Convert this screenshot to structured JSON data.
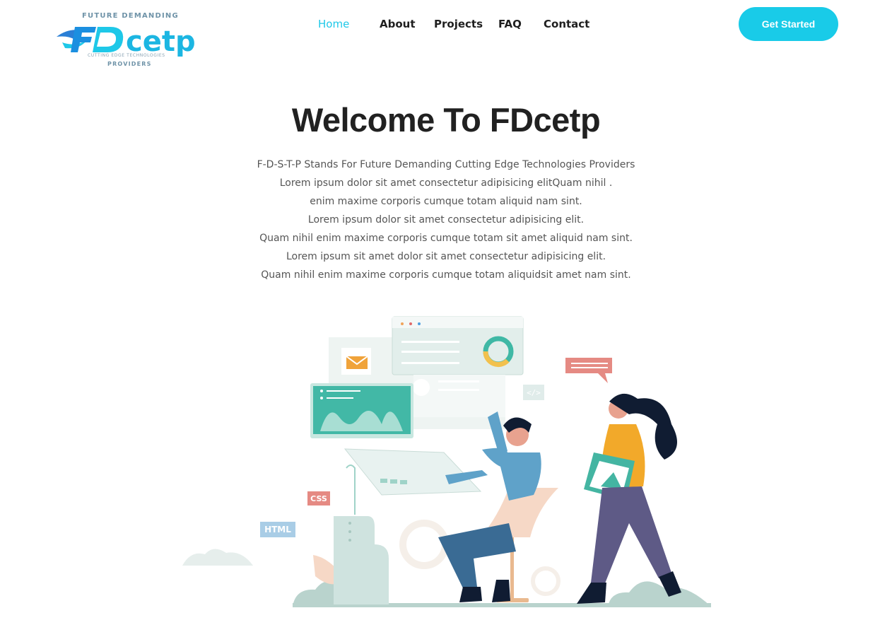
{
  "header": {
    "logo": {
      "top_text": "FUTURE DEMANDING",
      "mark_text": "FDcetp",
      "sub_text": "CUTTING EDGE TECHNOLOGIES",
      "bottom_text": "PROVIDERS"
    },
    "nav": [
      {
        "label": "Home",
        "active": true
      },
      {
        "label": "About",
        "active": false
      },
      {
        "label": "Projects",
        "active": false
      },
      {
        "label": "FAQ",
        "active": false
      },
      {
        "label": "Contact",
        "active": false
      }
    ],
    "cta_label": "Get Started"
  },
  "hero": {
    "title": "Welcome To FDcetp",
    "lines": [
      "F-D-S-T-P Stands For Future Demanding Cutting Edge Technologies Providers",
      "Lorem ipsum dolor sit amet consectetur adipisicing elitQuam nihil .",
      "enim maxime corporis cumque totam aliquid nam sint.",
      "Lorem ipsum dolor sit amet consectetur adipisicing elit.",
      "Quam nihil enim maxime corporis cumque totam sit amet aliquid nam sint.",
      "Lorem ipsum sit amet dolor sit amet consectetur adipisicing elit.",
      "Quam nihil enim maxime corporis cumque totam aliquidsit amet nam sint."
    ]
  },
  "illustration": {
    "css_tag": "CSS",
    "html_tag": "HTML",
    "code_tag": "</>"
  },
  "colors": {
    "accent": "#19cbe8",
    "heading": "#212121",
    "body_text": "#555555"
  }
}
